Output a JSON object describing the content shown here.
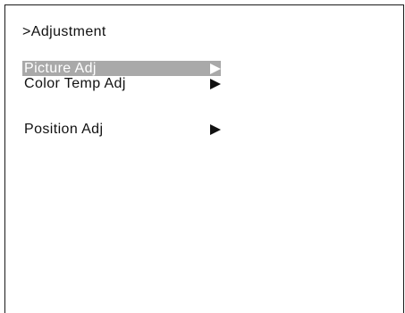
{
  "menu": {
    "title": ">Adjustment",
    "selected_index": 0,
    "items": [
      {
        "label": "Picture Adj",
        "arrow_icon": "right-triangle-icon",
        "selected": true
      },
      {
        "label": "Color Temp Adj",
        "arrow_icon": "right-triangle-icon",
        "selected": false
      },
      {
        "label": "Position Adj",
        "arrow_icon": "right-triangle-icon",
        "selected": false
      }
    ]
  },
  "colors": {
    "highlight": "#a9a9a9",
    "highlight_text": "#ffffff",
    "text": "#111111",
    "background": "#ffffff"
  }
}
